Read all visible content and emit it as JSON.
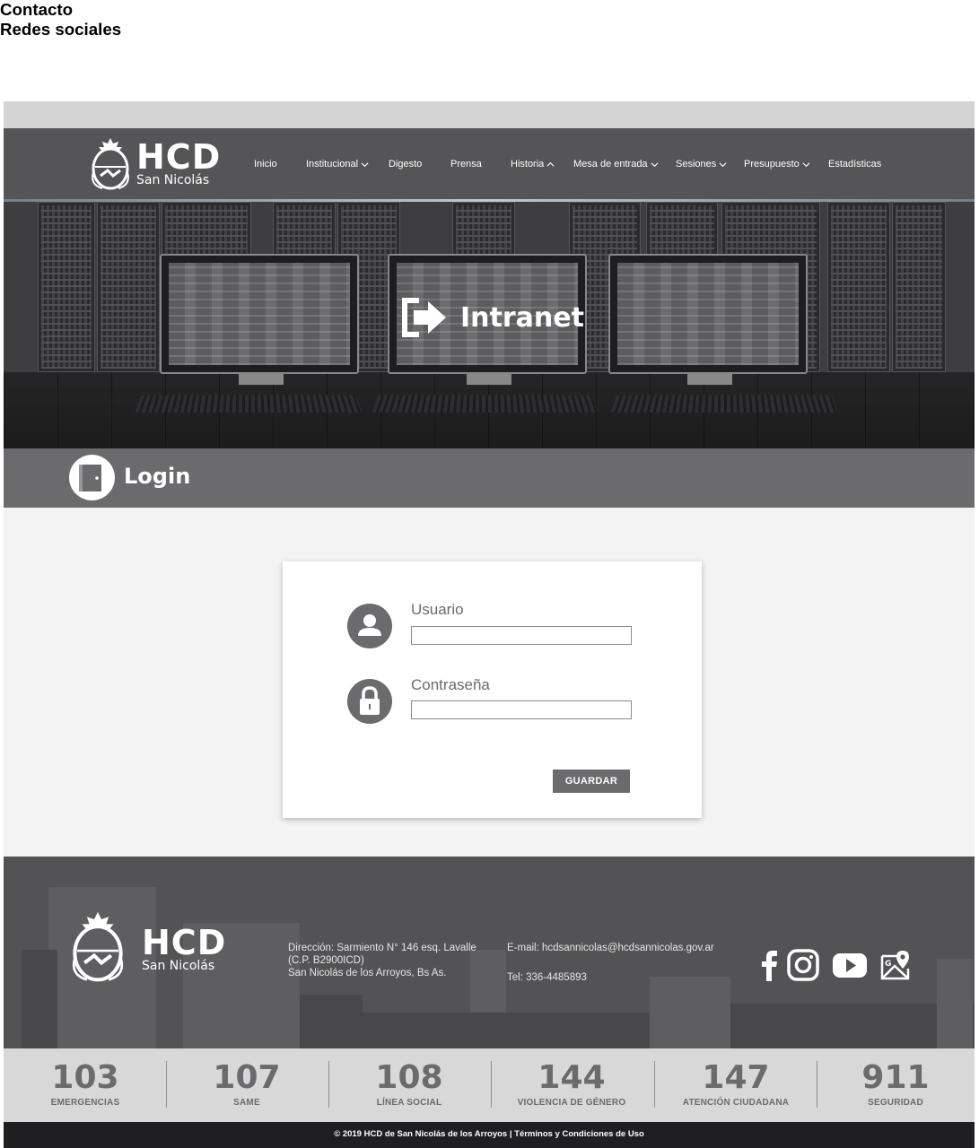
{
  "header": {
    "logo_title": "HCD",
    "logo_subtitle": "San Nicolás",
    "nav": [
      {
        "label": "Inicio",
        "has_chevron": false,
        "chevron": ""
      },
      {
        "label": "Institucional",
        "has_chevron": true,
        "chevron": "down"
      },
      {
        "label": "Digesto",
        "has_chevron": false,
        "chevron": ""
      },
      {
        "label": "Prensa",
        "has_chevron": false,
        "chevron": ""
      },
      {
        "label": "Historia",
        "has_chevron": true,
        "chevron": "up"
      },
      {
        "label": "Mesa de entrada",
        "has_chevron": true,
        "chevron": "down"
      },
      {
        "label": "Sesiones",
        "has_chevron": true,
        "chevron": "down"
      },
      {
        "label": "Presupuesto",
        "has_chevron": true,
        "chevron": "down"
      },
      {
        "label": "Estadísticas",
        "has_chevron": false,
        "chevron": ""
      }
    ]
  },
  "hero": {
    "title": "Intranet",
    "icon": "login-arrow-icon"
  },
  "login_band": {
    "title": "Login",
    "icon": "door-icon"
  },
  "form": {
    "user_label": "Usuario",
    "user_value": "",
    "user_icon": "user-icon",
    "password_label": "Contraseña",
    "password_value": "",
    "password_icon": "lock-icon",
    "submit_label": "GUARDAR"
  },
  "footer": {
    "logo_title": "HCD",
    "logo_subtitle": "San Nicolás",
    "contact_title": "Contacto",
    "address_line1": "Dirección: Sarmiento N° 146 esq. Lavalle",
    "address_line2": "(C.P. B2900ICD)",
    "address_line3": "San Nicolás de los Arroyos, Bs As.",
    "email": "E-mail: hcdsannicolas@hcdsannicolas.gov.ar",
    "phone": "Tel: 336-4485893",
    "social_title": "Redes sociales",
    "social_icons": [
      "facebook-icon",
      "instagram-icon",
      "youtube-icon",
      "google-maps-icon"
    ]
  },
  "emergency": [
    {
      "number": "103",
      "label": "EMERGENCIAS"
    },
    {
      "number": "107",
      "label": "SAME"
    },
    {
      "number": "108",
      "label": "LÍNEA SOCIAL"
    },
    {
      "number": "144",
      "label": "VIOLENCIA DE GÉNERO"
    },
    {
      "number": "147",
      "label": "ATENCIÓN CIUDADANA"
    },
    {
      "number": "911",
      "label": "SEGURIDAD"
    }
  ],
  "copyright": "© 2019 HCD de San Nicolás de los Arroyos | Términos y Condiciones de Uso",
  "colors": {
    "header_bg": "#555557",
    "band_bg": "#6b6b6d",
    "content_bg": "#f3f3f3",
    "footer_bg": "#535355",
    "numbers_bg": "#d8d8d8",
    "copyright_bg": "#1f1f21"
  }
}
